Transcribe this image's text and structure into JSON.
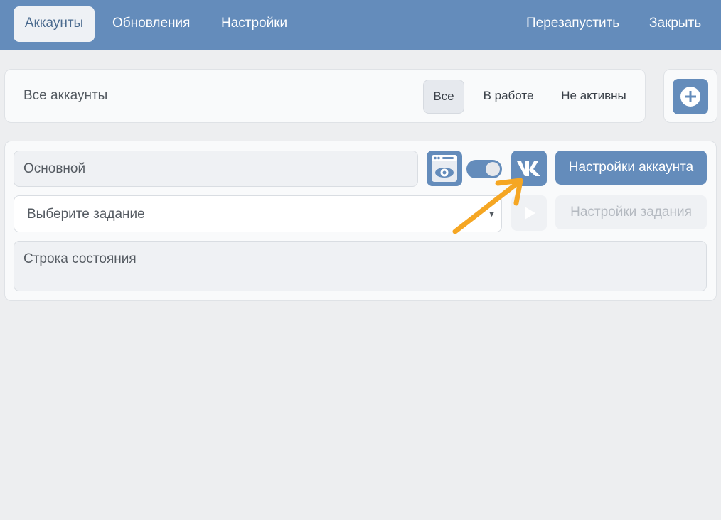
{
  "nav": {
    "tabs": [
      {
        "label": "Аккаунты",
        "active": true
      },
      {
        "label": "Обновления",
        "active": false
      },
      {
        "label": "Настройки",
        "active": false
      }
    ],
    "actions": [
      {
        "label": "Перезапустить"
      },
      {
        "label": "Закрыть"
      }
    ]
  },
  "filter": {
    "title": "Все аккаунты",
    "options": [
      {
        "label": "Все",
        "active": true
      },
      {
        "label": "В работе",
        "active": false
      },
      {
        "label": "Не активны",
        "active": false
      }
    ],
    "add_icon": "plus-circle-icon"
  },
  "account": {
    "name_value": "Основной",
    "browser_icon": "browser-eye-icon",
    "toggle_on": true,
    "vk_icon": "vk-logo-icon",
    "settings_label": "Настройки аккаунта",
    "task_placeholder": "Выберите задание",
    "play_icon": "play-icon",
    "task_settings_label": "Настройки задания",
    "status_text": "Строка состояния"
  },
  "annotation": {
    "arrow_icon": "pointer-arrow-icon",
    "arrow_color": "#f5a623"
  },
  "colors": {
    "accent": "#648cbb",
    "background": "#edeef0"
  }
}
